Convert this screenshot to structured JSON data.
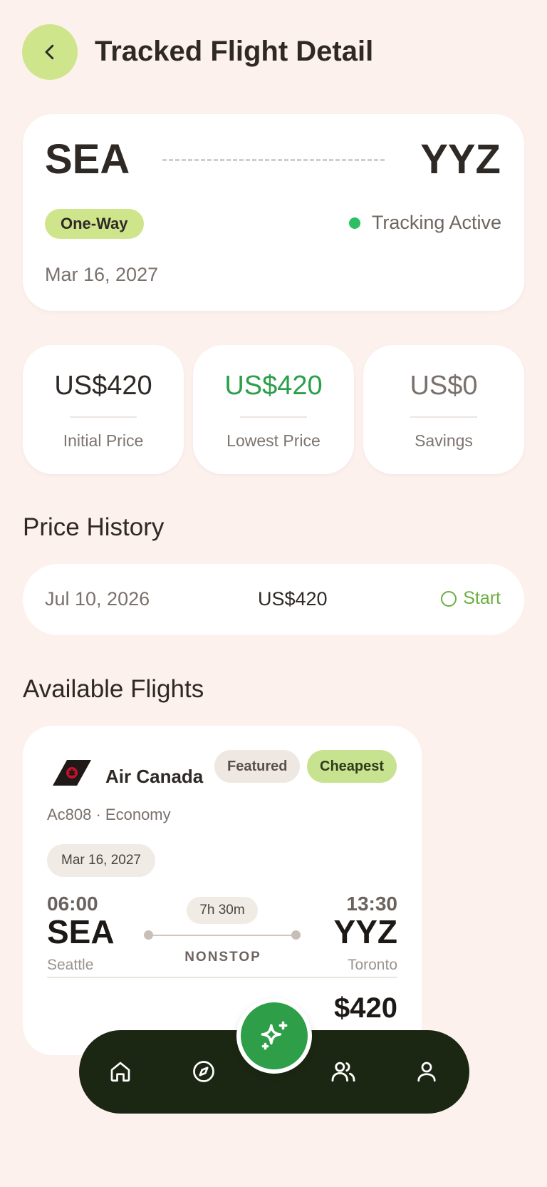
{
  "header": {
    "title": "Tracked Flight Detail"
  },
  "route": {
    "origin": "SEA",
    "destination": "YYZ",
    "trip_type": "One-Way",
    "status": "Tracking Active",
    "date": "Mar 16, 2027"
  },
  "stats": [
    {
      "value": "US$420",
      "label": "Initial Price",
      "color": "#2f2926"
    },
    {
      "value": "US$420",
      "label": "Lowest Price",
      "color": "#2b9f4b"
    },
    {
      "value": "US$0",
      "label": "Savings",
      "color": "#7a716c"
    }
  ],
  "price_history": {
    "title": "Price History",
    "rows": [
      {
        "date": "Jul 10, 2026",
        "price": "US$420",
        "status": "Start"
      }
    ]
  },
  "available_flights": {
    "title": "Available Flights",
    "flights": [
      {
        "airline": "Air Canada",
        "tags": [
          "Featured",
          "Cheapest"
        ],
        "meta": "Ac808 · Economy",
        "date": "Mar 16, 2027",
        "departure_time": "06:00",
        "departure_code": "SEA",
        "departure_city": "Seattle",
        "arrival_time": "13:30",
        "arrival_code": "YYZ",
        "arrival_city": "Toronto",
        "duration": "7h 30m",
        "stops": "NONSTOP",
        "price": "$420"
      }
    ]
  },
  "bottom_nav": {
    "items": [
      "home-icon",
      "compass-icon",
      "users-icon",
      "profile-icon"
    ],
    "fab_icon": "sparkles-icon"
  },
  "colors": {
    "background": "#fdf1ed",
    "accent_lime": "#cfe58c",
    "accent_green": "#2e9e48",
    "nav_dark": "#1c2713",
    "tracking_dot": "#2bbf62"
  }
}
